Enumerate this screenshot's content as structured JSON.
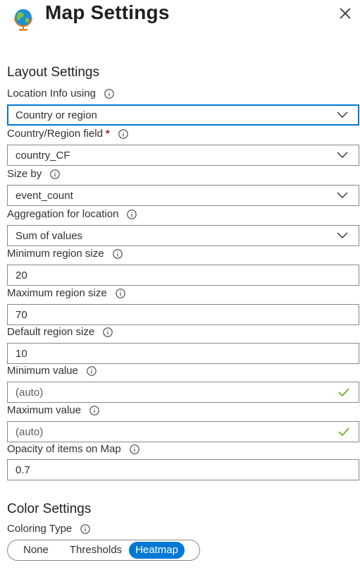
{
  "header": {
    "title": "Map Settings",
    "close_icon": "close-icon"
  },
  "layout_section": {
    "title": "Layout Settings"
  },
  "fields": {
    "location_info": {
      "label": "Location Info using",
      "value": "Country or region"
    },
    "country_field": {
      "label": "Country/Region field",
      "required": "*",
      "value": "country_CF"
    },
    "size_by": {
      "label": "Size by",
      "value": "event_count"
    },
    "aggregation": {
      "label": "Aggregation for location",
      "value": "Sum of values"
    },
    "min_region": {
      "label": "Minimum region size",
      "value": "20"
    },
    "max_region": {
      "label": "Maximum region size",
      "value": "70"
    },
    "default_region": {
      "label": "Default region size",
      "value": "10"
    },
    "min_value": {
      "label": "Minimum value",
      "value": "(auto)"
    },
    "max_value": {
      "label": "Maximum value",
      "value": "(auto)"
    },
    "opacity": {
      "label": "Opacity of items on Map",
      "value": "0.7"
    }
  },
  "color_section": {
    "title": "Color Settings",
    "coloring_type_label": "Coloring Type",
    "options": [
      "None",
      "Thresholds",
      "Heatmap"
    ],
    "selected": "Heatmap"
  },
  "colors": {
    "accent": "#0078d4",
    "valid": "#57a300",
    "required": "#a4262c"
  }
}
